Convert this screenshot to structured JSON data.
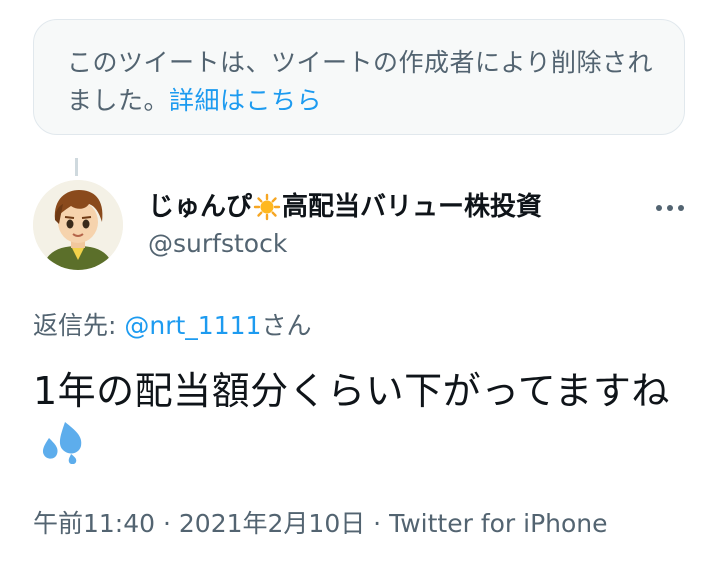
{
  "deleted_notice": {
    "text": "このツイートは、ツイートの作成者により削除されました。",
    "link": "詳細はこちら"
  },
  "author": {
    "name_part1": "じゅんぴ",
    "name_emoji": "sun-icon",
    "name_part2": "高配当バリュー株投資",
    "handle": "@surfstock"
  },
  "reply": {
    "prefix": "返信先: ",
    "mention": "@nrt_1111",
    "suffix": "さん"
  },
  "tweet": {
    "text": "1年の配当額分くらい下がってますね",
    "emoji": "sweat-droplets-icon"
  },
  "meta": {
    "time": "午前11:40",
    "date": "2021年2月10日",
    "source": "Twitter for iPhone",
    "separator": " · "
  },
  "colors": {
    "link": "#1d9bf0",
    "secondary_text": "#536471",
    "primary_text": "#0f1419"
  }
}
